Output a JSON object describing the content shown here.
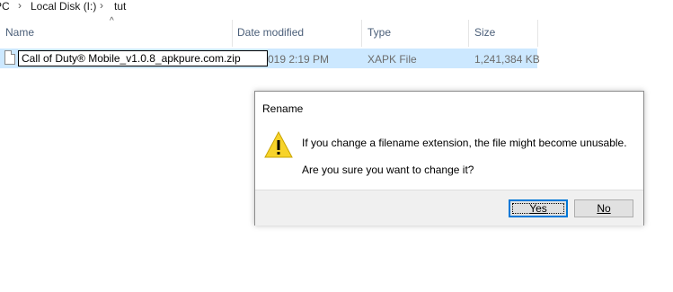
{
  "breadcrumb": {
    "items": [
      "PC",
      "Local Disk (I:)",
      "tut"
    ],
    "separator": "›"
  },
  "columns": {
    "name": "Name",
    "date_modified": "Date modified",
    "type": "Type",
    "size": "Size",
    "sorted_by": "Name",
    "sort_direction": "ascending"
  },
  "file": {
    "rename_value": "Call of Duty® Mobile_v1.0.8_apkpure.com.zip",
    "date_modified_visible": "019 2:19 PM",
    "type": "XAPK File",
    "size": "1,241,384 KB",
    "selected": true
  },
  "dialog": {
    "title": "Rename",
    "icon": "warning-icon",
    "message_line1": "If you change a filename extension, the file might become unusable.",
    "message_line2": "Are you sure you want to change it?",
    "yes_label": "Yes",
    "no_label": "No",
    "default_button": "Yes"
  },
  "colors": {
    "selection": "#cce8ff",
    "header_text": "#4c607a",
    "warning_yellow": "#f7d32a",
    "focus_border": "#0078d7"
  }
}
